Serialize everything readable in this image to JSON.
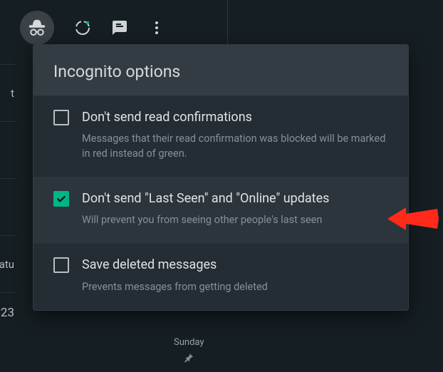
{
  "header": {},
  "panel": {
    "title": "Incognito options",
    "options": [
      {
        "label": "Don't send read confirmations",
        "desc": "Messages that their read confirmation was blocked will be marked in red instead of green.",
        "checked": false
      },
      {
        "label": "Don't send \"Last Seen\" and \"Online\" updates",
        "desc": "Will prevent you from seeing other people's last seen",
        "checked": true
      },
      {
        "label": "Save deleted messages",
        "desc": "Prevents messages from getting deleted",
        "checked": false
      }
    ]
  },
  "background": {
    "sidebar_cut_1": "t",
    "sidebar_cut_2": "Satu",
    "sidebar_cut_3": "23",
    "day_label": "Sunday"
  },
  "colors": {
    "accent": "#00b686"
  }
}
